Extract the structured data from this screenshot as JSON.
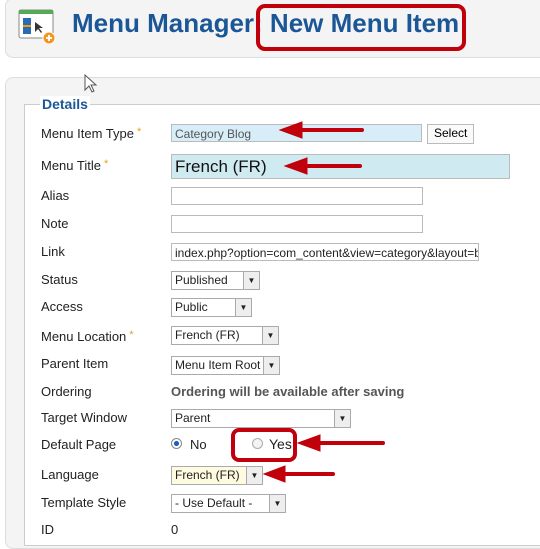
{
  "header": {
    "title_prefix": "Menu Manager:",
    "title_highlight": "New Menu Item",
    "icon": "menu-add-icon"
  },
  "details": {
    "legend": "Details",
    "menu_item_type": {
      "label": "Menu Item Type",
      "value": "Category Blog",
      "select_label": "Select"
    },
    "menu_title": {
      "label": "Menu Title",
      "value": "French (FR)"
    },
    "alias": {
      "label": "Alias",
      "value": ""
    },
    "note": {
      "label": "Note",
      "value": ""
    },
    "link": {
      "label": "Link",
      "value": "index.php?option=com_content&view=category&layout=b"
    },
    "status": {
      "label": "Status",
      "value": "Published"
    },
    "access": {
      "label": "Access",
      "value": "Public"
    },
    "menu_location": {
      "label": "Menu Location",
      "value": "French (FR)"
    },
    "parent_item": {
      "label": "Parent Item",
      "value": "Menu Item Root"
    },
    "ordering": {
      "label": "Ordering",
      "value": "Ordering will be available after saving"
    },
    "target_window": {
      "label": "Target Window",
      "value": "Parent"
    },
    "default_page": {
      "label": "Default Page",
      "options": [
        "No",
        "Yes"
      ],
      "selected": "No"
    },
    "language": {
      "label": "Language",
      "value": "French (FR)"
    },
    "template_style": {
      "label": "Template Style",
      "value": "- Use Default -"
    },
    "id": {
      "label": "ID",
      "value": "0"
    },
    "required_mark": "*"
  },
  "colors": {
    "title": "#1b5796",
    "annotation": "#c0000b",
    "highlight": "#cfeaf7",
    "language_bg": "#fffbe0"
  }
}
